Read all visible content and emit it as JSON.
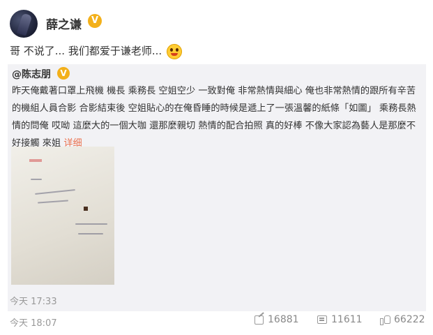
{
  "author": {
    "name": "薛之谦",
    "verified_badge": "V"
  },
  "post": {
    "text": "哥 不说了... 我们都爱于谦老师...",
    "emoji": "smiling-face-emoji"
  },
  "repost": {
    "user": "@陈志朋",
    "verified_badge": "V",
    "body": "昨天俺戴著口罩上飛機 機長 乘務長 空姐空少 一致對俺 非常熱情與細心 俺也非常熱情的跟所有辛苦的機組人員合影 合影結束後 空姐貼心的在俺昏睡的時候是遞上了一張溫馨的紙條「如圖」 乘務長熱情的問俺 哎呦 這麼大的一個大咖 還那麼親切 熱情的配合拍照 真的好棒 不像大家認為藝人是那麼不好接觸 來姐",
    "more_link": "详细",
    "time": "今天 17:33"
  },
  "footer": {
    "time": "今天 18:07",
    "share_count": "16881",
    "comment_count": "11611",
    "like_count": "66222"
  },
  "colors": {
    "badge": "#f3b01a",
    "link": "#eb7350",
    "repost_bg": "#f2f2f5"
  }
}
